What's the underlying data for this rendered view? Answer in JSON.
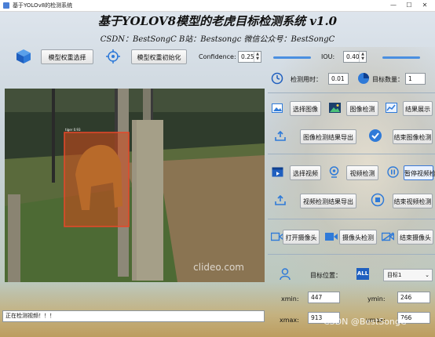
{
  "window": {
    "title": "基于YOLOv8的检测系统",
    "min": "—",
    "max": "☐",
    "close": "✕"
  },
  "header": {
    "title": "基于YOLOV8模型的老虎目标检测系统 v1.0",
    "subtitle": "CSDN：BestSongC   B站：Bestsongc   微信公众号：BestSongC"
  },
  "toolbar": {
    "select_weights": "模型权重选择",
    "init_weights": "模型权重初始化",
    "confidence_label": "Confidence:",
    "confidence_value": "0.25",
    "iou_label": "IOU:",
    "iou_value": "0.40"
  },
  "stats": {
    "time_label": "检测用时：",
    "time_value": "0.01",
    "count_label": "目标数量：",
    "count_value": "1"
  },
  "image_section": {
    "select_image": "选择图像",
    "detect_image": "图像检测",
    "show_result": "结果展示",
    "export_image": "图像检测结果导出",
    "stop_image": "结束图像检测"
  },
  "video_section": {
    "select_video": "选择视频",
    "detect_video": "视频检测",
    "pause_video": "暂停视频检测",
    "export_video": "视频检测结果导出",
    "stop_video": "结束视频检测"
  },
  "camera_section": {
    "open_camera": "打开摄像头",
    "detect_camera": "摄像头检测",
    "close_camera": "结束摄像头"
  },
  "target": {
    "position_label": "目标位置：",
    "all_label": "ALL",
    "selected": "目标1",
    "xmin_label": "xmin:",
    "xmin": "447",
    "ymin_label": "ymin:",
    "ymin": "246",
    "xmax_label": "xmax:",
    "xmax": "913",
    "ymax_label": "ymax:",
    "ymax": "766"
  },
  "video": {
    "overlay_watermark": "clideo.com",
    "detection_label": "tiger 0.93"
  },
  "status_bar": {
    "text": "正在检测视频！！！"
  },
  "watermark": "CSDN @BestSongC",
  "colors": {
    "accent": "#4a8fe0",
    "bbox": "#e8472a",
    "button_active_border": "#3a78d6"
  }
}
